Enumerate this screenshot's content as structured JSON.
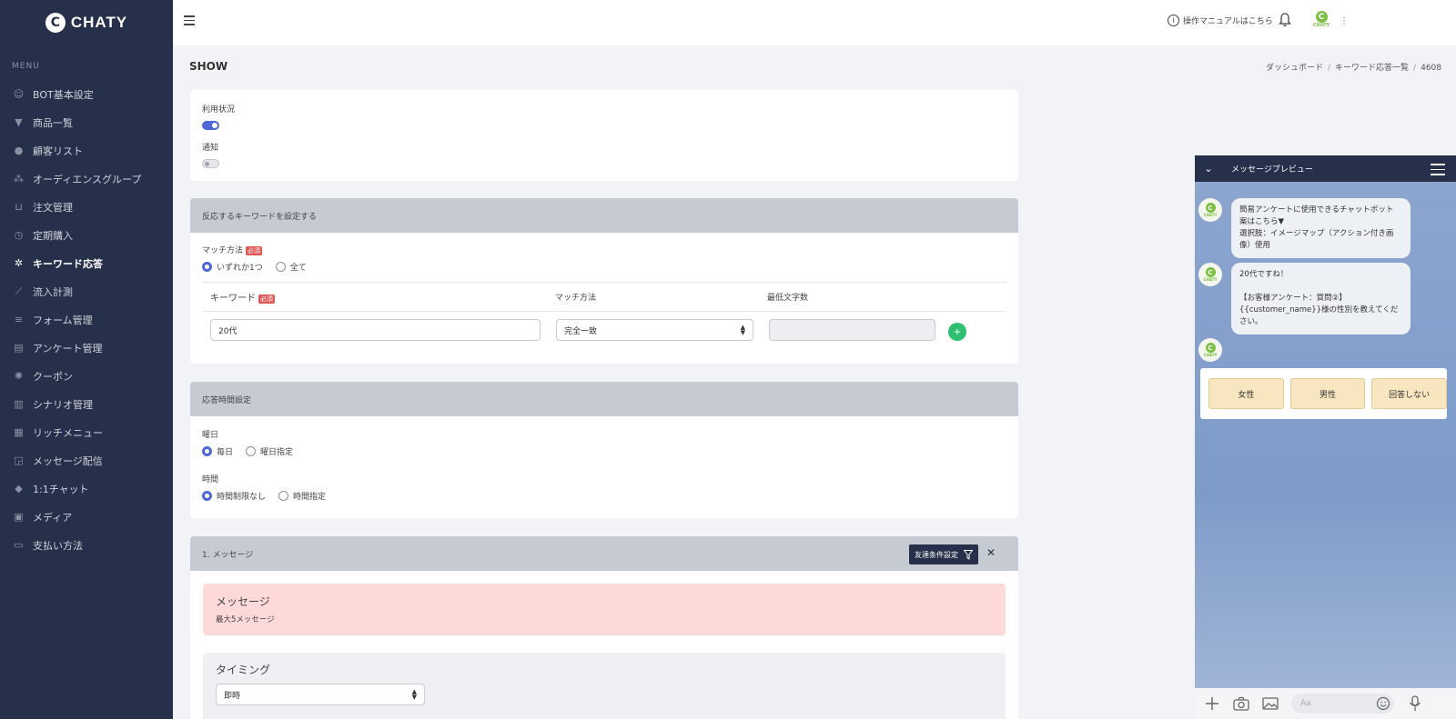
{
  "app": {
    "logo_text": "CHATY",
    "logo_letter": "C"
  },
  "sidebar": {
    "menu_heading": "MENU",
    "items": [
      {
        "label": "BOT基本設定",
        "icon": "robot-icon"
      },
      {
        "label": "商品一覧",
        "icon": "shirt-icon"
      },
      {
        "label": "顧客リスト",
        "icon": "user-icon"
      },
      {
        "label": "オーディエンスグループ",
        "icon": "users-icon"
      },
      {
        "label": "注文管理",
        "icon": "cart-icon"
      },
      {
        "label": "定期購入",
        "icon": "clock-icon"
      },
      {
        "label": "キーワード応答",
        "icon": "gear-icon"
      },
      {
        "label": "流入計測",
        "icon": "chart-icon"
      },
      {
        "label": "フォーム管理",
        "icon": "form-icon"
      },
      {
        "label": "アンケート管理",
        "icon": "survey-icon"
      },
      {
        "label": "クーポン",
        "icon": "coupon-icon"
      },
      {
        "label": "シナリオ管理",
        "icon": "book-icon"
      },
      {
        "label": "リッチメニュー",
        "icon": "grid-icon"
      },
      {
        "label": "メッセージ配信",
        "icon": "broadcast-icon"
      },
      {
        "label": "1:1チャット",
        "icon": "chat-icon"
      },
      {
        "label": "メディア",
        "icon": "media-icon"
      },
      {
        "label": "支払い方法",
        "icon": "card-icon"
      }
    ],
    "active_index": 6
  },
  "topbar": {
    "help_label": "操作マニュアルはこちら",
    "avatar_text": "CHATY",
    "avatar_letter": "C",
    "more": "⋮"
  },
  "page": {
    "title": "SHOW",
    "breadcrumb": [
      "ダッシュボード",
      "キーワード応答一覧",
      "4608"
    ]
  },
  "status_card": {
    "usage_label": "利用状況",
    "usage_on": true,
    "notify_label": "通知",
    "notify_on": false
  },
  "keyword_card": {
    "heading": "反応するキーワードを設定する",
    "match_label": "マッチ方法",
    "required": "必須",
    "match_options": [
      "いずれか1つ",
      "全て"
    ],
    "table_headers": [
      "キーワード",
      "マッチ方法",
      "最低文字数"
    ],
    "row": {
      "keyword": "20代",
      "match": "完全一致",
      "min_chars": ""
    },
    "add_symbol": "+"
  },
  "time_card": {
    "heading": "応答時間設定",
    "day_label": "曜日",
    "day_options": [
      "毎日",
      "曜日指定"
    ],
    "time_label": "時間",
    "time_options": [
      "時間制限なし",
      "時間指定"
    ]
  },
  "message_card": {
    "heading": "1. メッセージ",
    "filter_button": "友達条件設定",
    "close_symbol": "✕",
    "alert_title": "メッセージ",
    "alert_sub": "最大5メッセージ",
    "timing_label": "タイミング",
    "timing_value": "即時"
  },
  "preview": {
    "title": "メッセージプレビュー",
    "avatar_letter": "C",
    "avatar_text": "CHATY",
    "bubble1": [
      "簡易アンケートに使用できるチャットボット",
      "案はこちら▼",
      "選択肢：イメージマップ（アクション付き画",
      "像）使用"
    ],
    "bubble2": [
      "20代ですね！",
      "",
      "【お客様アンケート：質問②】",
      "{{customer_name}}様の性別を教えてくだ",
      "さい。"
    ],
    "choices": [
      "女性",
      "男性",
      "回答しない"
    ],
    "input_placeholder": "Aa"
  },
  "colors": {
    "sidebar": "#27304a",
    "accent": "#4f67d8",
    "green": "#2fbf71",
    "alert": "#fdd9d9",
    "choice": "#f7e6bf"
  }
}
